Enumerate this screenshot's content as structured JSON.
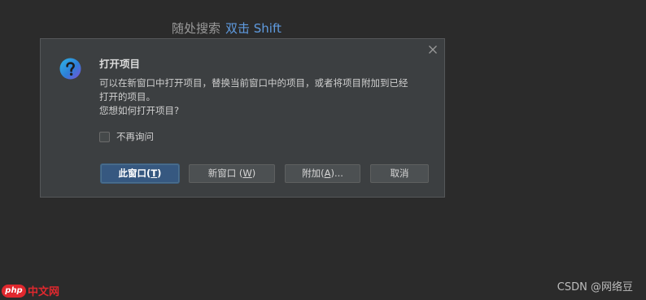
{
  "hint": {
    "text": "随处搜索",
    "key": "双击 Shift"
  },
  "dialog": {
    "title": "打开项目",
    "message_line1": "可以在新窗口中打开项目，替换当前窗口中的项目，或者将项目附加到已经",
    "message_line2": "打开的项目。",
    "message_line3": "您想如何打开项目?",
    "checkbox_label": "不再询问",
    "checkbox_checked": false,
    "buttons": {
      "this_window": {
        "label": "此窗口(",
        "mnemonic": "T",
        "suffix": ")"
      },
      "new_window": {
        "label": "新窗口 (",
        "mnemonic": "W",
        "suffix": ")"
      },
      "attach": {
        "label": "附加(",
        "mnemonic": "A",
        "suffix": ")..."
      },
      "cancel": {
        "label": "取消"
      }
    }
  },
  "watermark": "CSDN @网络豆",
  "logo": {
    "badge": "php",
    "text": "中文网"
  },
  "colors": {
    "background": "#2b2b2b",
    "dialog": "#3c3f41",
    "primary_button": "#365880",
    "accent": "#5f9be0"
  }
}
